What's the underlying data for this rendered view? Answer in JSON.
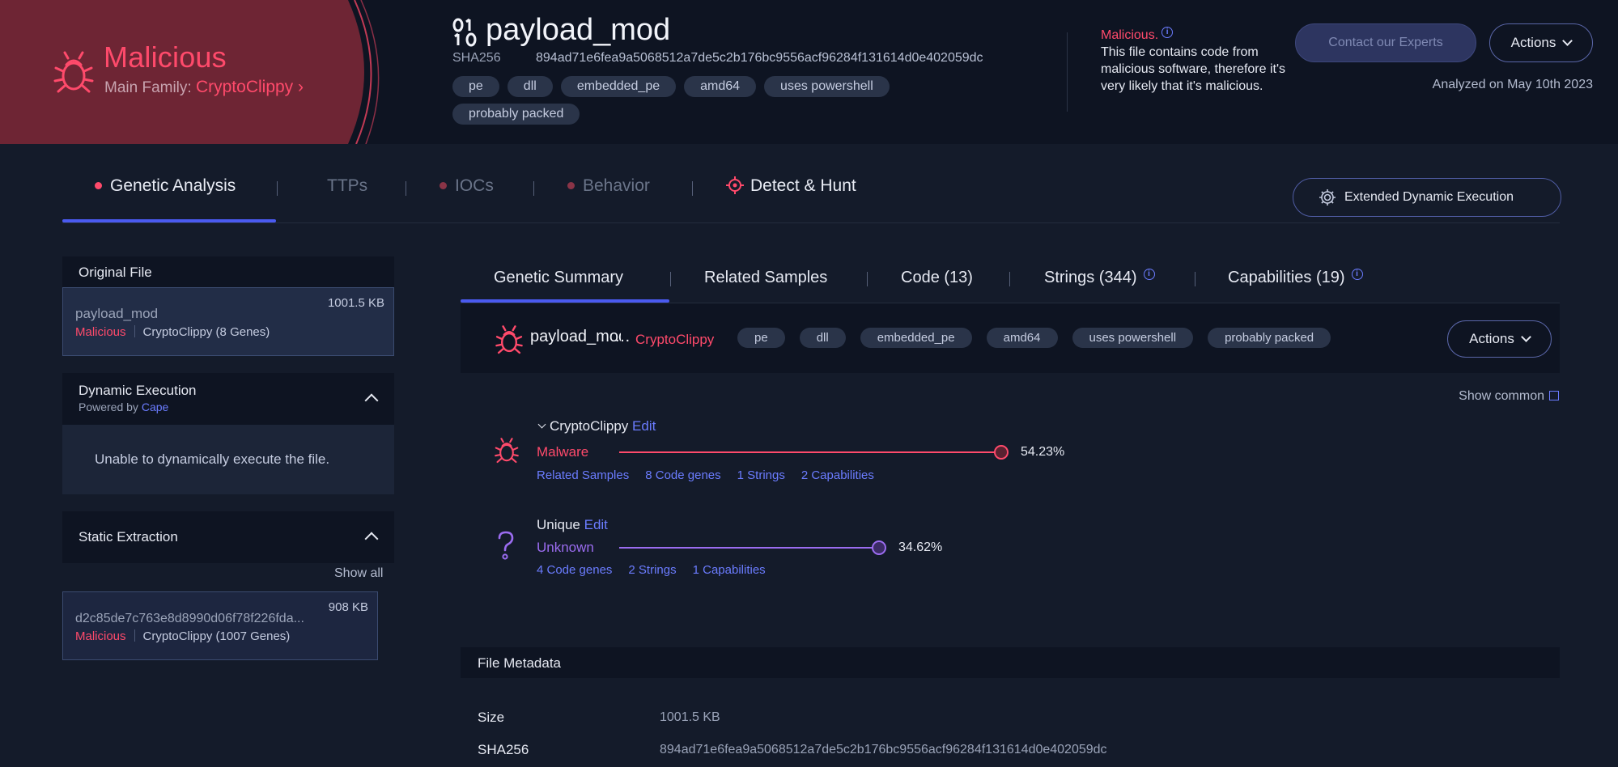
{
  "verdict": {
    "title": "Malicious",
    "family_label": "Main Family:",
    "family": "CryptoClippy",
    "family_chevron": "›"
  },
  "file": {
    "name": "payload_mod",
    "sha_label": "SHA256",
    "sha256": "894ad71e6fea9a5068512a7de5c2b176bc9556acf96284f131614d0e402059dc",
    "tags": [
      "pe",
      "dll",
      "embedded_pe",
      "amd64",
      "uses powershell",
      "probably packed"
    ]
  },
  "malicious_note": {
    "label": "Malicious.",
    "info": "i",
    "text": "This file contains code from malicious software, therefore it's very likely that it's malicious."
  },
  "header_buttons": {
    "contact": "Contact our Experts",
    "actions": "Actions"
  },
  "analyzed": "Analyzed on May 10th 2023",
  "main_tabs": [
    {
      "label": "Genetic Analysis",
      "dot": true
    },
    {
      "label": "TTPs",
      "dot": false
    },
    {
      "label": "IOCs",
      "dot": true
    },
    {
      "label": "Behavior",
      "dot": true
    },
    {
      "label": "Detect & Hunt",
      "dot": false
    }
  ],
  "extended_button": "Extended Dynamic Execution",
  "original_file": {
    "header": "Original File",
    "name": "payload_mod",
    "size": "1001.5 KB",
    "verdict": "Malicious",
    "family": "CryptoClippy (8 Genes)"
  },
  "dynamic_execution": {
    "title": "Dynamic Execution",
    "powered_by": "Powered by",
    "engine": "Cape",
    "message": "Unable to dynamically execute the file."
  },
  "static_extraction": {
    "title": "Static Extraction",
    "show_all": "Show all",
    "item": {
      "hash": "d2c85de7c763e8d8990d06f78f226fda...",
      "size": "908 KB",
      "verdict": "Malicious",
      "family": "CryptoClippy (1007 Genes)"
    }
  },
  "sub_tabs": [
    {
      "label": "Genetic Summary"
    },
    {
      "label": "Related Samples"
    },
    {
      "label": "Code (13)"
    },
    {
      "label": "Strings (344)",
      "info": "i"
    },
    {
      "label": "Capabilities (19)",
      "info": "i"
    }
  ],
  "sample_bar": {
    "name": "payload_mod",
    "family": "CryptoClippy",
    "tags": [
      "pe",
      "dll",
      "embedded_pe",
      "amd64",
      "uses powershell",
      "probably packed"
    ],
    "actions": "Actions"
  },
  "show_common": "Show common",
  "genes": [
    {
      "name": "CryptoClippy",
      "edit": "Edit",
      "category": "Malware",
      "percent": "54.23%",
      "percent_value": 54.23,
      "color": "#ff4a6b",
      "links": [
        "Related Samples",
        "8 Code genes",
        "1 Strings",
        "2 Capabilities"
      ]
    },
    {
      "name": "Unique",
      "edit": "Edit",
      "category": "Unknown",
      "percent": "34.62%",
      "percent_value": 34.62,
      "color": "#9b6cf0",
      "links": [
        "4 Code genes",
        "2 Strings",
        "1 Capabilities"
      ]
    }
  ],
  "file_metadata": {
    "header": "File Metadata",
    "rows": [
      {
        "key": "Size",
        "value": "1001.5 KB"
      },
      {
        "key": "SHA256",
        "value": "894ad71e6fea9a5068512a7de5c2b176bc9556acf96284f131614d0e402059dc"
      }
    ]
  },
  "colors": {
    "malicious": "#ff4a6b",
    "accent": "#4a5af0",
    "link": "#6b7cff",
    "unknown": "#9b6cf0"
  }
}
